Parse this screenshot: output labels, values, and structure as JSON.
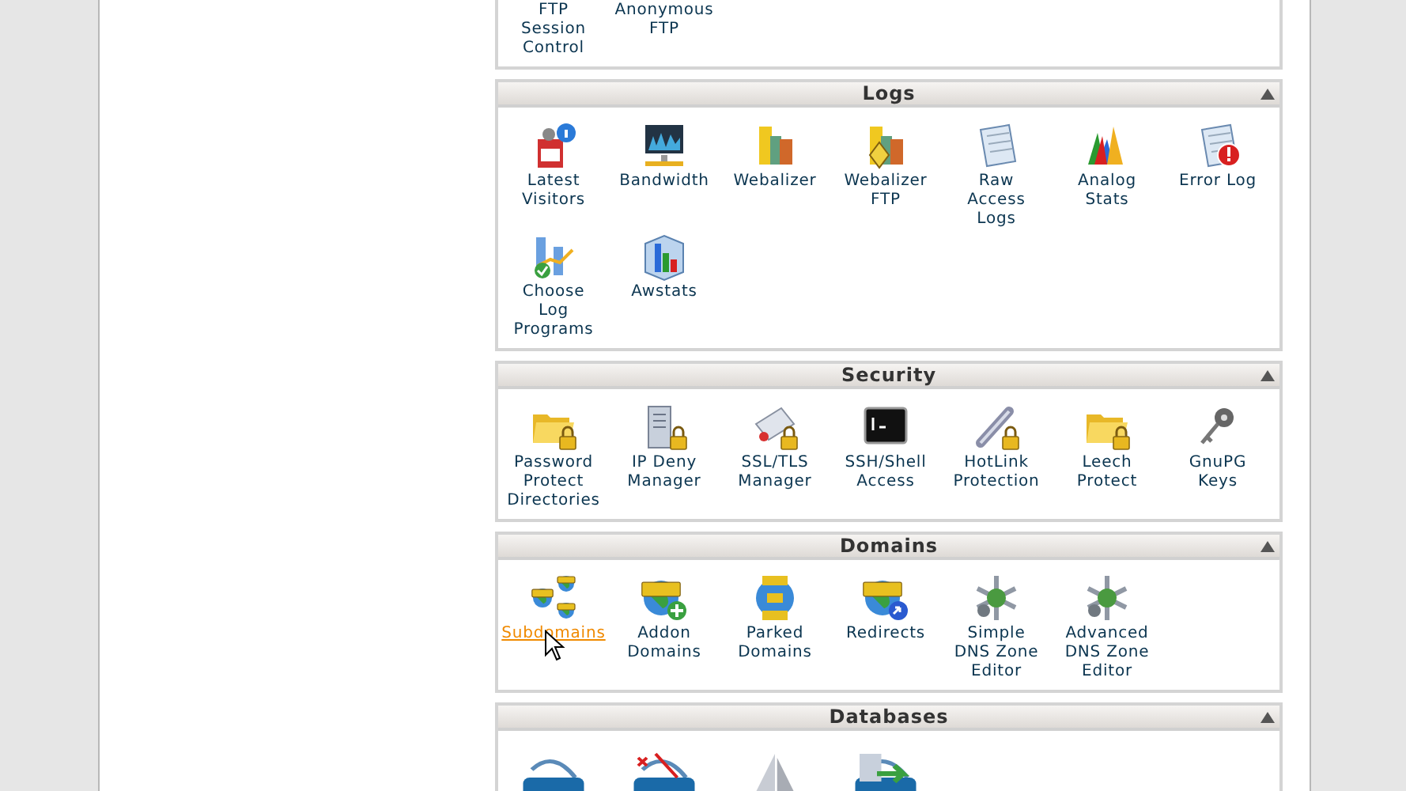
{
  "sections": [
    {
      "items": [
        {
          "label": "FTP Session Control",
          "hovered": false
        },
        {
          "label": "Anonymous FTP",
          "hovered": false
        }
      ]
    },
    {
      "title": "Logs",
      "items": [
        {
          "label": "Latest Visitors",
          "hovered": false
        },
        {
          "label": "Bandwidth",
          "hovered": false
        },
        {
          "label": "Webalizer",
          "hovered": false
        },
        {
          "label": "Webalizer FTP",
          "hovered": false
        },
        {
          "label": "Raw Access Logs",
          "hovered": false
        },
        {
          "label": "Analog Stats",
          "hovered": false
        },
        {
          "label": "Error Log",
          "hovered": false
        },
        {
          "label": "Choose Log Programs",
          "hovered": false
        },
        {
          "label": "Awstats",
          "hovered": false
        }
      ]
    },
    {
      "title": "Security",
      "items": [
        {
          "label": "Password Protect Directories",
          "hovered": false
        },
        {
          "label": "IP Deny Manager",
          "hovered": false
        },
        {
          "label": "SSL/TLS Manager",
          "hovered": false
        },
        {
          "label": "SSH/Shell Access",
          "hovered": false
        },
        {
          "label": "HotLink Protection",
          "hovered": false
        },
        {
          "label": "Leech Protect",
          "hovered": false
        },
        {
          "label": "GnuPG Keys",
          "hovered": false
        }
      ]
    },
    {
      "title": "Domains",
      "items": [
        {
          "label": "Subdomains",
          "hovered": true
        },
        {
          "label": "Addon Domains",
          "hovered": false
        },
        {
          "label": "Parked Domains",
          "hovered": false
        },
        {
          "label": "Redirects",
          "hovered": false
        },
        {
          "label": "Simple DNS Zone Editor",
          "hovered": false
        },
        {
          "label": "Advanced DNS Zone Editor",
          "hovered": false
        }
      ]
    },
    {
      "title": "Databases",
      "items": [
        {
          "kind": "label-cut"
        },
        {
          "kind": "label-cut"
        },
        {
          "kind": "label-cut"
        },
        {
          "kind": "label-cut"
        }
      ]
    }
  ]
}
